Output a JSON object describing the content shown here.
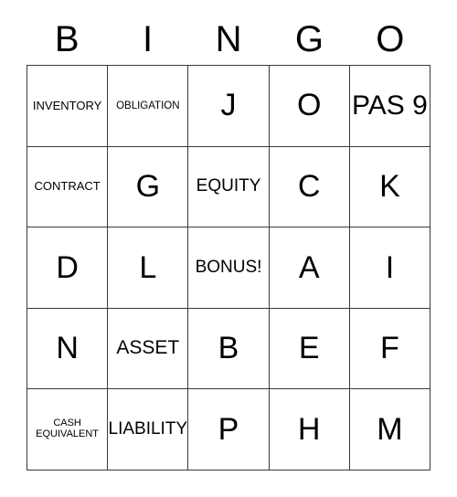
{
  "header": {
    "letters": [
      "B",
      "I",
      "N",
      "G",
      "O"
    ]
  },
  "grid": {
    "rows": [
      [
        {
          "text": "INVENTORY",
          "size": "xs"
        },
        {
          "text": "OBLIGATION",
          "size": "xxs"
        },
        {
          "text": "J",
          "size": "xl"
        },
        {
          "text": "O",
          "size": "xl"
        },
        {
          "text": "PAS 9",
          "size": "lg"
        }
      ],
      [
        {
          "text": "CONTRACT",
          "size": "xs"
        },
        {
          "text": "G",
          "size": "xl"
        },
        {
          "text": "EQUITY",
          "size": "sm"
        },
        {
          "text": "C",
          "size": "xl"
        },
        {
          "text": "K",
          "size": "xl"
        }
      ],
      [
        {
          "text": "D",
          "size": "xl"
        },
        {
          "text": "L",
          "size": "xl"
        },
        {
          "text": "BONUS!",
          "size": "sm"
        },
        {
          "text": "A",
          "size": "xl"
        },
        {
          "text": "I",
          "size": "xl"
        }
      ],
      [
        {
          "text": "N",
          "size": "xl"
        },
        {
          "text": "ASSET",
          "size": "md"
        },
        {
          "text": "B",
          "size": "xl"
        },
        {
          "text": "E",
          "size": "xl"
        },
        {
          "text": "F",
          "size": "xl"
        }
      ],
      [
        {
          "text": "CASH\nEQUIVALENT",
          "size": "tiny"
        },
        {
          "text": "LIABILITY",
          "size": "sm"
        },
        {
          "text": "P",
          "size": "xl"
        },
        {
          "text": "H",
          "size": "xl"
        },
        {
          "text": "M",
          "size": "xl"
        }
      ]
    ]
  },
  "style": {
    "border_color": "#3a3a3a",
    "text_color": "#000000",
    "background": "#ffffff"
  }
}
